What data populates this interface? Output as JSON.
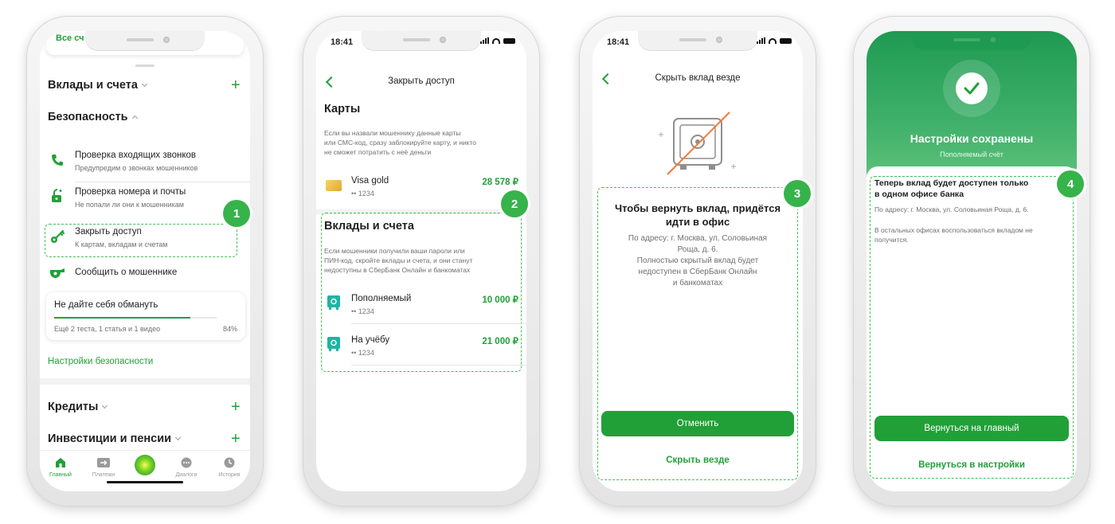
{
  "screen1": {
    "top_card_text": "Все сч",
    "section_deposits": "Вклады и счета",
    "section_security": "Безопасность",
    "items": [
      {
        "title": "Проверка входящих звонков",
        "subtitle": "Предупредим о звонках мошенников",
        "icon": "phone-icon"
      },
      {
        "title": "Проверка номера и почты",
        "subtitle": "Не попали ли они к мошенникам",
        "icon": "lock-icon"
      },
      {
        "title": "Закрыть доступ",
        "subtitle": "К картам, вкладам и счетам",
        "icon": "key-icon"
      },
      {
        "title": "Сообщить о мошеннике",
        "subtitle": "",
        "icon": "whistle-icon"
      }
    ],
    "promo": {
      "title": "Не дайте себя обмануть",
      "detail": "Ещё 2 теста, 1 статья и 1 видео",
      "progress_text": "84%",
      "progress": 0.84
    },
    "security_settings_link": "Настройки безопасности",
    "section_credits": "Кредиты",
    "section_investments": "Инвестиции и пенсии",
    "tabbar": [
      {
        "label": "Главный",
        "icon": "home-icon"
      },
      {
        "label": "Платежи",
        "icon": "transfer-icon"
      },
      {
        "label": "",
        "icon": "assistant-orb-icon"
      },
      {
        "label": "Диалоги",
        "icon": "chat-icon"
      },
      {
        "label": "История",
        "icon": "clock-icon"
      }
    ],
    "badge": "1"
  },
  "screen2": {
    "time": "18:41",
    "title": "Закрыть доступ",
    "cards_heading": "Карты",
    "cards_text": "Если вы назвали мошеннику данные карты\nили СМС-код, сразу заблокируйте карту, и никто\nне сможет потратить с неё деньги",
    "card": {
      "name": "Visa gold",
      "mask": "•• 1234",
      "amount": "28 578 ₽"
    },
    "deposits_heading": "Вклады и счета",
    "deposits_text": "Если мошенники получили ваши пароли или\nПИН-код, скройте вклады и счета, и они станут\nнедоступны в СберБанк Онлайн и банкоматах",
    "accounts": [
      {
        "name": "Пополняемый",
        "mask": "•• 1234",
        "amount": "10 000 ₽"
      },
      {
        "name": "На учёбу",
        "mask": "•• 1234",
        "amount": "21 000 ₽"
      }
    ],
    "badge": "2"
  },
  "screen3": {
    "time": "18:41",
    "title": "Скрыть вклад везде",
    "heading": "Чтобы вернуть вклад, придётся\nидти в офис",
    "text": "По адресу: г. Москва, ул. Соловьиная\nРоща, д. 6.\nПолностью скрытый вклад будет\nнедоступен в СберБанк Онлайн\nи банкоматах",
    "cancel_button": "Отменить",
    "hide_link": "Скрыть везде",
    "badge": "3"
  },
  "screen4": {
    "title": "Настройки сохранены",
    "subtitle": "Пополняемый счёт",
    "heading": "Теперь вклад будет доступен только\nв одном офисе банка",
    "address": "По адресу: г. Москва, ул. Соловьиная Роща, д. 6.",
    "note": "В остальных офисах воспользоваться вкладом не\nполучится.",
    "home_button": "Вернуться на главный",
    "settings_link": "Вернуться в настройки",
    "badge": "4"
  },
  "colors": {
    "accent": "#21a038",
    "badge": "#36b34a",
    "header_gradient_top": "#1f9a52",
    "header_gradient_bottom": "#5fc27a"
  }
}
